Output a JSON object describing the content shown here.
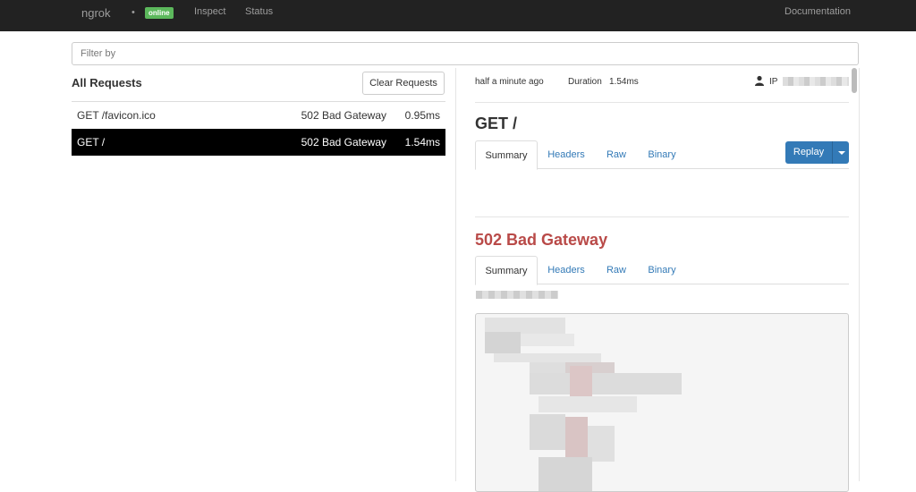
{
  "navbar": {
    "brand": "ngrok",
    "dot": "•",
    "status": "online",
    "links": [
      "Inspect",
      "Status"
    ],
    "documentation": "Documentation"
  },
  "filter": {
    "placeholder": "Filter by",
    "value": ""
  },
  "requests": {
    "title": "All Requests",
    "clear_label": "Clear Requests",
    "rows": [
      {
        "request": "GET /favicon.ico",
        "status": "502 Bad Gateway",
        "duration": "0.95ms"
      },
      {
        "request": "GET /",
        "status": "502 Bad Gateway",
        "duration": "1.54ms"
      }
    ]
  },
  "detail": {
    "time_ago": "half a minute ago",
    "duration_label": "Duration",
    "duration_value": "1.54ms",
    "ip_label": "IP",
    "request_title": "GET /",
    "request_tabs": [
      "Summary",
      "Headers",
      "Raw",
      "Binary"
    ],
    "replay_label": "Replay",
    "response_title": "502 Bad Gateway",
    "response_tabs": [
      "Summary",
      "Headers",
      "Raw",
      "Binary"
    ]
  },
  "colors": {
    "navbar": "#222222",
    "online": "#5cb85c",
    "link": "#337ab7",
    "error": "#b94a48",
    "selected_row": "#000000"
  },
  "icons": [
    "user-icon",
    "caret-down-icon"
  ]
}
